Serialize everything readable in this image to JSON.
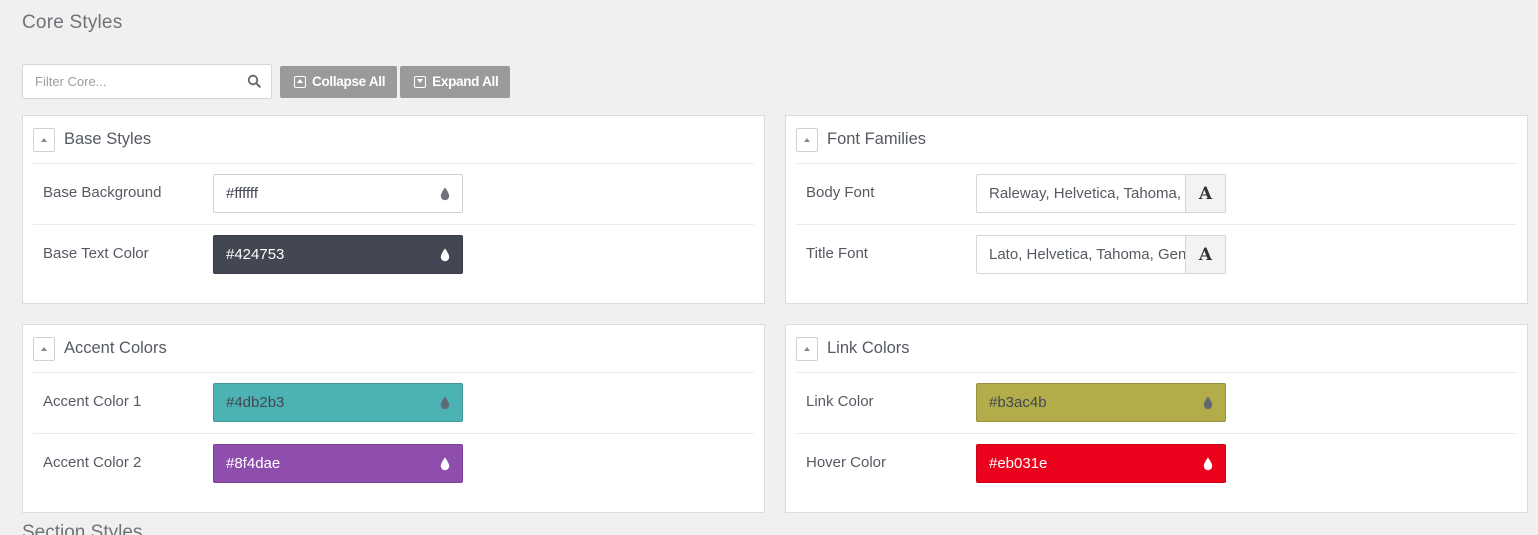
{
  "page_title": "Core Styles",
  "next_section_title": "Section Styles",
  "toolbar": {
    "filter_placeholder": "Filter Core...",
    "filter_value": "",
    "collapse_label": "Collapse All",
    "expand_label": "Expand All"
  },
  "panels": {
    "base_styles": {
      "title": "Base Styles",
      "rows": [
        {
          "label": "Base Background",
          "value": "#ffffff",
          "swatch": "#ffffff",
          "text_color": "#424753",
          "icon_color": "#6f7378"
        },
        {
          "label": "Base Text Color",
          "value": "#424753",
          "swatch": "#424753",
          "text_color": "#ffffff",
          "icon_color": "#ffffff"
        }
      ]
    },
    "font_families": {
      "title": "Font Families",
      "rows": [
        {
          "label": "Body Font",
          "value": "Raleway, Helvetica, Tahoma, Geneva, Arial, sans-serif",
          "button_glyph": "A"
        },
        {
          "label": "Title Font",
          "value": "Lato, Helvetica, Tahoma, Geneva, Arial, sans-serif",
          "button_glyph": "A"
        }
      ]
    },
    "accent_colors": {
      "title": "Accent Colors",
      "rows": [
        {
          "label": "Accent Color 1",
          "value": "#4db2b3",
          "swatch": "#4db2b3",
          "text_color": "#424753",
          "icon_color": "#5f6a74"
        },
        {
          "label": "Accent Color 2",
          "value": "#8f4dae",
          "swatch": "#8f4dae",
          "text_color": "#ffffff",
          "icon_color": "#ffffff"
        }
      ]
    },
    "link_colors": {
      "title": "Link Colors",
      "rows": [
        {
          "label": "Link Color",
          "value": "#b3ac4b",
          "swatch": "#b3ac4b",
          "text_color": "#424753",
          "icon_color": "#5f6a74"
        },
        {
          "label": "Hover Color",
          "value": "#eb031e",
          "swatch": "#eb031e",
          "text_color": "#ffffff",
          "icon_color": "#ffffff"
        }
      ]
    }
  }
}
